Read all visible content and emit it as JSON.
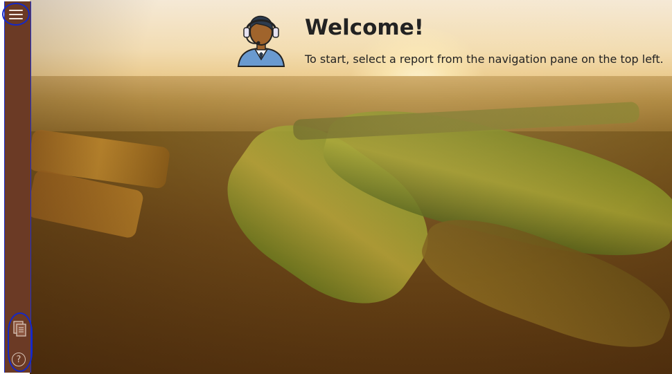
{
  "welcome": {
    "title": "Welcome!",
    "subtitle": "To start, select a report from the navigation pane on the top left."
  },
  "sidebar": {
    "background": "#6b3a25",
    "menu_icon": "hamburger-menu-icon",
    "pages_icon": "report-pages-icon",
    "help_icon": "help-icon",
    "help_glyph": "?"
  },
  "colors": {
    "annotation_outline": "#1428c8",
    "headset_avatar_skin": "#a0642c",
    "headset_avatar_shirt": "#6a9ad0"
  }
}
